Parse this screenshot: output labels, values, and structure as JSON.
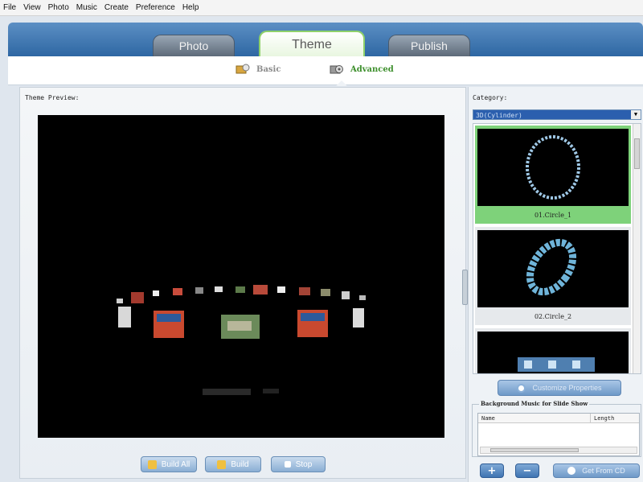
{
  "menu": [
    "File",
    "View",
    "Photo",
    "Music",
    "Create",
    "Preference",
    "Help"
  ],
  "main_tabs": [
    {
      "label": "Photo"
    },
    {
      "label": "Theme"
    },
    {
      "label": "Publish"
    }
  ],
  "active_main_tab": "Theme",
  "sub_tabs": [
    {
      "label": "Basic"
    },
    {
      "label": "Advanced"
    }
  ],
  "active_sub_tab": "Advanced",
  "preview": {
    "label": "Theme Preview:"
  },
  "buttons": {
    "build_all": "Build All",
    "build": "Build",
    "stop": "Stop"
  },
  "category": {
    "label": "Category:",
    "selected": "3D(Cylinder)"
  },
  "themes": [
    {
      "caption": "01.Circle_1",
      "selected": true
    },
    {
      "caption": "02.Circle_2",
      "selected": false
    },
    {
      "caption": "",
      "selected": false
    }
  ],
  "customize_label": "Customize Properties",
  "bg_music": {
    "label": "Background Music for Slide Show",
    "columns": [
      "Name",
      "Length"
    ]
  },
  "music_buttons": {
    "add": "+",
    "remove": "−",
    "get_from_cd": "Get From CD"
  },
  "colors": {
    "accent_blue": "#2e67a3",
    "selected_green": "#7ed27a",
    "advanced_green": "#3d8f2c"
  }
}
